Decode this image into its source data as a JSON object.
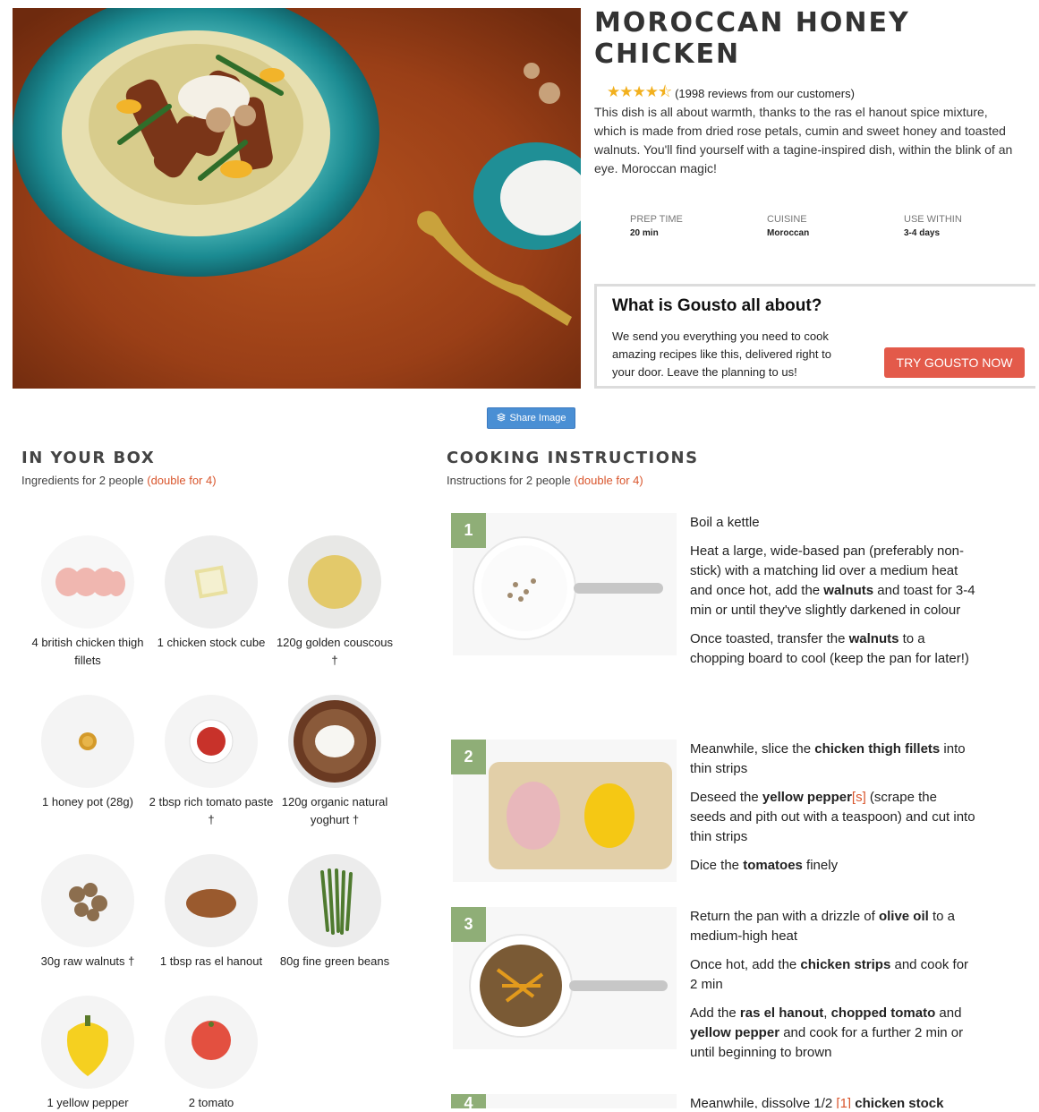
{
  "recipe": {
    "title": "Moroccan Honey Chicken",
    "rating_stars": 4.5,
    "reviews_text": "(1998 reviews from our customers)",
    "description": "This dish is all about warmth, thanks to the ras el hanout spice mixture, which is made from dried rose petals, cumin and sweet honey and toasted walnuts. You'll find yourself with a tagine-inspired dish, within the blink of an eye. Moroccan magic!",
    "meta": [
      {
        "label": "PREP TIME",
        "value": "20 min"
      },
      {
        "label": "CUISINE",
        "value": "Moroccan"
      },
      {
        "label": "USE WITHIN",
        "value": "3-4 days"
      }
    ]
  },
  "promo": {
    "heading": "What is Gousto all about?",
    "text": "We send you everything you need to cook amazing recipes like this, delivered right to your door. Leave the planning to us!",
    "cta": "TRY GOUSTO NOW"
  },
  "share": {
    "label": "Share Image"
  },
  "box": {
    "title": "In Your Box",
    "subtitle": "Ingredients for 2 people",
    "double": "(double for 4)",
    "ingredients": [
      {
        "label": "4 british chicken thigh fillets"
      },
      {
        "label": "1 chicken stock cube"
      },
      {
        "label": "120g golden couscous †"
      },
      {
        "label": "1 honey pot (28g)"
      },
      {
        "label": "2 tbsp rich tomato paste †"
      },
      {
        "label": "120g organic natural yoghurt †"
      },
      {
        "label": "30g raw walnuts †"
      },
      {
        "label": "1 tbsp ras el hanout"
      },
      {
        "label": "80g fine green beans"
      },
      {
        "label": "1 yellow pepper"
      },
      {
        "label": "2 tomato"
      }
    ]
  },
  "cooking": {
    "title": "Cooking Instructions",
    "subtitle": "Instructions for 2 people",
    "double": "(double for 4)",
    "steps": [
      {
        "number": "1"
      },
      {
        "number": "2"
      },
      {
        "number": "3"
      },
      {
        "number": "4"
      }
    ],
    "text": {
      "s1a": "Boil a kettle",
      "s1b_1": "Heat a large, wide-based pan (preferably non-stick) with a matching lid over a medium heat and once hot, add the ",
      "s1b_b": "walnuts",
      "s1b_2": " and toast for 3-4 min or until they've slightly darkened in colour",
      "s1c_1": "Once toasted, transfer the ",
      "s1c_b": "walnuts",
      "s1c_2": " to a chopping board to cool (keep the pan for later!)",
      "s2a_1": "Meanwhile, slice the ",
      "s2a_b": "chicken thigh fillets",
      "s2a_2": " into thin strips",
      "s2b_1": "Deseed the ",
      "s2b_b": "yellow pepper",
      "s2b_r": "[s]",
      "s2b_2": " (scrape the seeds and pith out with a teaspoon) and cut into thin strips",
      "s2c_1": "Dice the ",
      "s2c_b": "tomatoes",
      "s2c_2": " finely",
      "s3a_1": "Return the pan with a drizzle of ",
      "s3a_b": "olive oil",
      "s3a_2": " to a medium-high heat",
      "s3b_1": "Once hot, add the ",
      "s3b_b": "chicken strips",
      "s3b_2": " and cook for 2 min",
      "s3c_1": "Add the ",
      "s3c_b1": "ras el hanout",
      "s3c_c": ", ",
      "s3c_b2": "chopped tomato",
      "s3c_and": " and ",
      "s3c_b3": "yellow pepper",
      "s3c_2": " and cook for a further 2 min or until beginning to brown",
      "s4a_1": "Meanwhile, dissolve 1/2 ",
      "s4a_r": "[1]",
      "s4a_b": " chicken stock"
    }
  },
  "colors": {
    "accent": "#d9562d",
    "cta": "#e35a4a",
    "step_badge": "#8fae77",
    "star": "#f2b01e",
    "share": "#4a8fd4"
  }
}
